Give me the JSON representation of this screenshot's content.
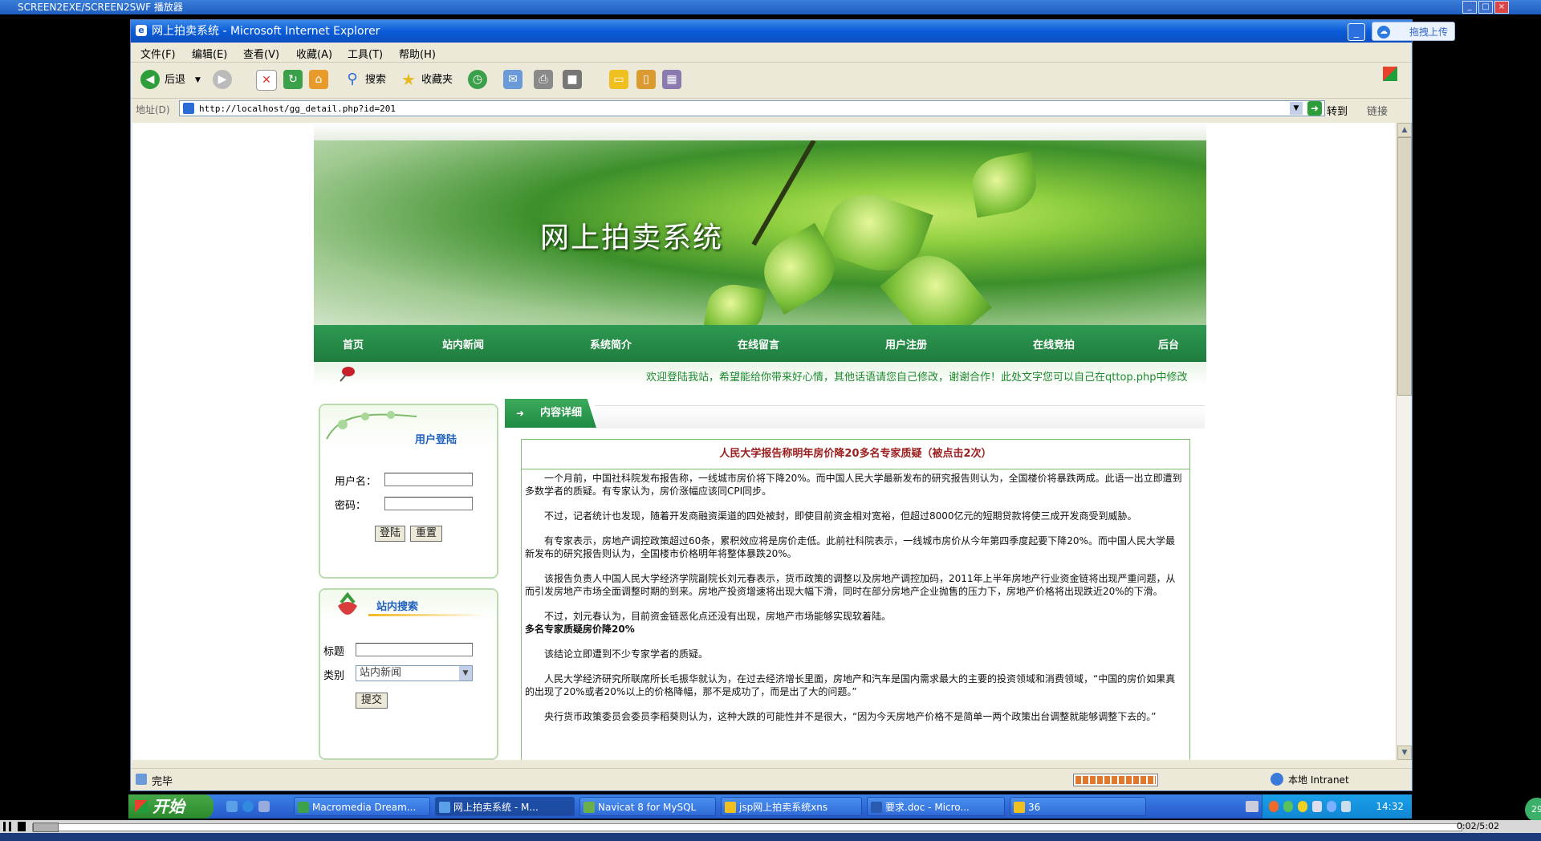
{
  "player": {
    "title": "SCREEN2EXE/SCREEN2SWF 播放器",
    "time": "0:02/5:02"
  },
  "browser": {
    "title": "网上拍卖系统 - Microsoft Internet Explorer",
    "upload_label": "拖拽上传",
    "menus": [
      "文件(F)",
      "编辑(E)",
      "查看(V)",
      "收藏(A)",
      "工具(T)",
      "帮助(H)"
    ],
    "toolbar": {
      "back": "后退",
      "search": "搜索",
      "favorites": "收藏夹"
    },
    "address_label": "地址(D)",
    "url": "http://localhost/gg_detail.php?id=201",
    "go_label": "转到",
    "links_label": "链接",
    "status_text": "完毕",
    "zone_text": "本地 Intranet"
  },
  "site": {
    "title": "网上拍卖系统",
    "nav": [
      "首页",
      "站内新闻",
      "系统简介",
      "在线留言",
      "用户注册",
      "在线竞拍",
      "后台"
    ],
    "marquee": "欢迎登陆我站，希望能给你带来好心情，其他话语请您自己修改，谢谢合作！此处文字您可以自己在qttop.php中修改"
  },
  "login": {
    "title": "用户登陆",
    "username_label": "用户名：",
    "password_label": "密码：",
    "login_button": "登陆",
    "reset_button": "重置"
  },
  "search": {
    "title": "站内搜索",
    "title_label": "标题",
    "category_label": "类别",
    "category_value": "站内新闻",
    "submit_button": "提交"
  },
  "content": {
    "tab_label": "内容详细",
    "headline": "人民大学报告称明年房价降20多名专家质疑（被点击2次）",
    "paragraphs": [
      "一个月前，中国社科院发布报告称，一线城市房价将下降20%。而中国人民大学最新发布的研究报告则认为，全国楼价将暴跌两成。此语一出立即遭到多数学者的质疑。有专家认为，房价涨幅应该同CPI同步。",
      "不过，记者统计也发现，随着开发商融资渠道的四处被封，即使目前资金相对宽裕，但超过8000亿元的短期贷款将使三成开发商受到威胁。",
      "有专家表示，房地产调控政策超过60条，累积效应将是房价走低。此前社科院表示，一线城市房价从今年第四季度起要下降20%。而中国人民大学最新发布的研究报告则认为，全国楼市价格明年将整体暴跌20%。",
      "该报告负责人中国人民大学经济学院副院长刘元春表示，货币政策的调整以及房地产调控加码，2011年上半年房地产行业资金链将出现严重问题，从而引发房地产市场全面调整时期的到来。房地产投资增速将出现大幅下滑，同时在部分房地产企业抛售的压力下，房地产价格将出现跌近20%的下滑。",
      "不过，刘元春认为，目前资金链恶化点还没有出现，房地产市场能够实现软着陆。"
    ],
    "subheading": "多名专家质疑房价降20%",
    "paragraphs2": [
      "该结论立即遭到不少专家学者的质疑。",
      "人民大学经济研究所联席所长毛振华就认为，在过去经济增长里面，房地产和汽车是国内需求最大的主要的投资领域和消费领域，“中国的房价如果真的出现了20%或者20%以上的价格降幅，那不是成功了，而是出了大的问题。”",
      "央行货币政策委员会委员李稻葵则认为，这种大跌的可能性并不是很大，“因为今天房地产价格不是简单一两个政策出台调整就能够调整下去的。”"
    ]
  },
  "taskbar": {
    "start": "开始",
    "tasks": [
      "Macromedia Dream...",
      "网上拍卖系统 - M...",
      "Navicat 8 for MySQL",
      "jsp网上拍卖系统xns",
      "要求.doc - Micro...",
      "36"
    ],
    "clock": "14:32"
  },
  "colors": {
    "nav_green": "#1f7c3e",
    "headline_red": "#9b1d1d",
    "marquee_green": "#1c8a2c",
    "box_title_blue": "#1f5fc0"
  }
}
